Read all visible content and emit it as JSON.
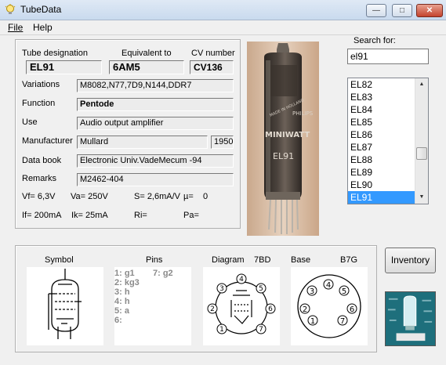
{
  "window": {
    "title": "TubeData",
    "min_glyph": "—",
    "max_glyph": "□",
    "close_glyph": "✕"
  },
  "menu": {
    "file": "File",
    "help": "Help"
  },
  "tube": {
    "designation_label": "Tube designation",
    "designation": "EL91",
    "equivalent_label": "Equivalent to",
    "equivalent": "6AM5",
    "cv_label": "CV number",
    "cv": "CV136",
    "variations_label": "Variations",
    "variations": "M8082,N77,7D9,N144,DDR7",
    "function_label": "Function",
    "function": "Pentode",
    "use_label": "Use",
    "use": "Audio output amplifier",
    "manufacturer_label": "Manufacturer",
    "manufacturer": "Mullard",
    "year": "1950",
    "databook_label": "Data book",
    "databook": "Electronic Univ.VadeMecum -94",
    "remarks_label": "Remarks",
    "remarks": "M2462-404"
  },
  "specs": {
    "vf": "Vf= 6,3V",
    "va": "Va= 250V",
    "s": "S= 2,6mA/V",
    "mu": "µ=",
    "mu_val": "0",
    "if": "If= 200mA",
    "ik": "Ik= 25mA",
    "ri": "Ri=",
    "pa": "Pa="
  },
  "photo": {
    "brand1": "MADE IN HOLLAND",
    "brand2": "PHILIPS",
    "brand3": "MINIWATT",
    "type": "EL91"
  },
  "search": {
    "label": "Search for:",
    "value": "el91"
  },
  "list": {
    "items": [
      "EL82",
      "EL83",
      "EL84",
      "EL85",
      "EL86",
      "EL87",
      "EL88",
      "EL89",
      "EL90",
      "EL91"
    ],
    "selected": "EL91"
  },
  "inventory_label": "Inventory",
  "bottom": {
    "symbol_label": "Symbol",
    "pins_label": "Pins",
    "diagram_label": "Diagram",
    "diagram_code": "7BD",
    "base_label": "Base",
    "base_code": "B7G",
    "pins_left": [
      "1: g1",
      "2: kg3",
      "3: h",
      "4: h",
      "5: a",
      "6:"
    ],
    "pins_right": [
      "7: g2"
    ]
  }
}
